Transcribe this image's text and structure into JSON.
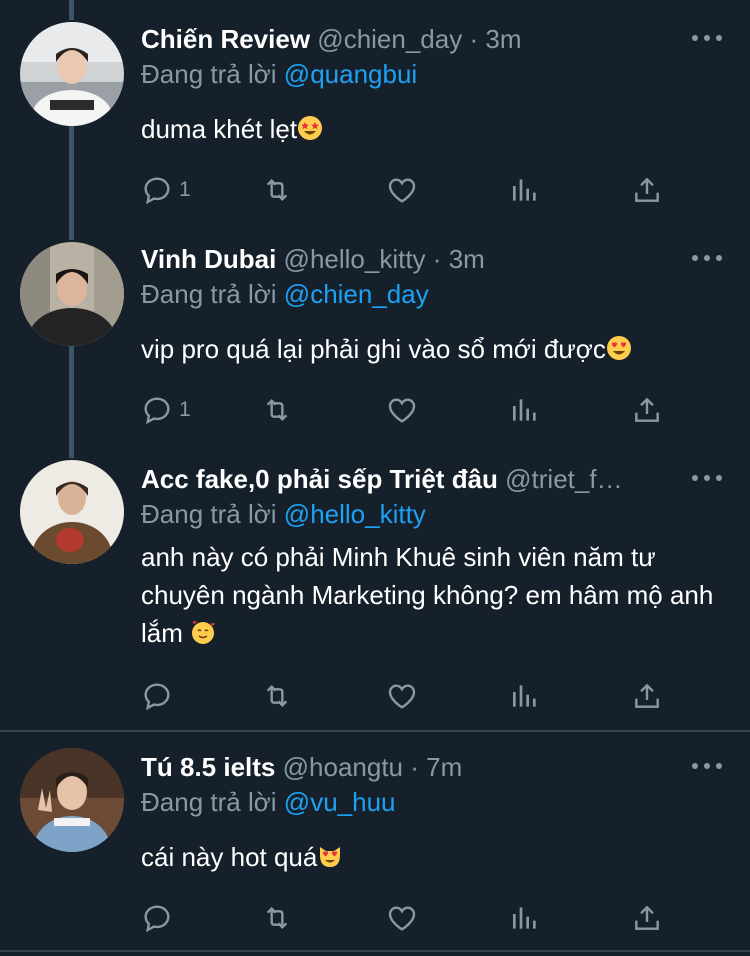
{
  "tweets": [
    {
      "name": "Chiến Review",
      "handle": "@chien_day",
      "time": "3m",
      "reply_prefix": "Đang trả lời",
      "reply_to": "@quangbui",
      "text": "duma khét lẹt",
      "emoji": "star-struck-emoji",
      "reply_count": "1",
      "avatar": "avatar-photo-white-hoodie"
    },
    {
      "name": "Vinh Dubai",
      "handle": "@hello_kitty",
      "time": "3m",
      "reply_prefix": "Đang trả lời",
      "reply_to": "@chien_day",
      "text": "vip pro quá lại phải ghi vào sổ mới được",
      "emoji": "heart-eyes-emoji",
      "reply_count": "1",
      "avatar": "avatar-photo-dark-jacket"
    },
    {
      "name": "Acc fake,0 phải sếp Triệt đâu",
      "handle": "@triet_f…",
      "time": "",
      "reply_prefix": "Đang trả lời",
      "reply_to": "@hello_kitty",
      "text": "anh này có phải Minh Khuê sinh viên năm tư chuyên ngành Marketing không? em hâm mộ anh lắm",
      "emoji": "smiling-hearts-emoji",
      "reply_count": "",
      "avatar": "avatar-photo-brown-coat"
    },
    {
      "name": "Tú 8.5 ielts",
      "handle": "@hoangtu",
      "time": "7m",
      "reply_prefix": "Đang trả lời",
      "reply_to": "@vu_huu",
      "text": "cái này hot quá",
      "emoji": "heart-eyes-cat-emoji",
      "reply_count": "",
      "avatar": "avatar-photo-peace-sign"
    }
  ],
  "separator": "·",
  "colors": {
    "background": "#15202b",
    "text": "#ffffff",
    "muted": "#8899a6",
    "link": "#1da1f2",
    "divider": "#38444d",
    "thread_line": "#3d5466"
  }
}
